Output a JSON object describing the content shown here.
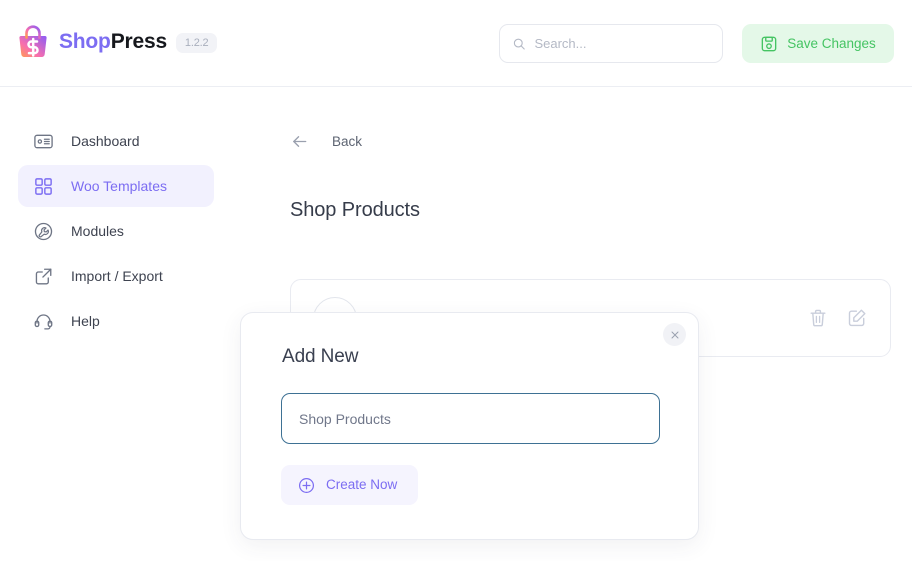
{
  "header": {
    "brand_shop": "Shop",
    "brand_press": "Press",
    "version": "1.2.2",
    "logo_icon": "shopping-bag-icon",
    "search": {
      "placeholder": "Search...",
      "value": "",
      "icon": "search-icon"
    },
    "save_button": {
      "label": "Save Changes",
      "icon": "save-disk-icon",
      "bg_color": "#e4f8e8",
      "text_color": "#45c463"
    }
  },
  "sidebar": {
    "active_index": 1,
    "active_bg": "#f2f1fe",
    "active_color": "#7c6df2",
    "items": [
      {
        "label": "Dashboard",
        "icon": "dashboard-card-icon"
      },
      {
        "label": "Woo Templates",
        "icon": "grid-squares-icon"
      },
      {
        "label": "Modules",
        "icon": "wrench-circle-icon"
      },
      {
        "label": "Import / Export",
        "icon": "export-box-arrow-icon"
      },
      {
        "label": "Help",
        "icon": "headset-icon"
      }
    ]
  },
  "main": {
    "back": {
      "label": "Back",
      "icon": "arrow-left-icon"
    },
    "page_title": "Shop Products",
    "card": {
      "delete_icon": "trash-icon",
      "edit_icon": "edit-pencil-square-icon"
    }
  },
  "modal": {
    "title": "Add New",
    "close_icon": "close-x-icon",
    "input": {
      "value": "Shop Products",
      "placeholder": "",
      "border_color": "#3e7194",
      "focused": true
    },
    "create_button": {
      "label": "Create Now",
      "icon": "plus-circle-icon",
      "bg_color": "#f5f4fe",
      "text_color": "#7c6df2"
    }
  }
}
